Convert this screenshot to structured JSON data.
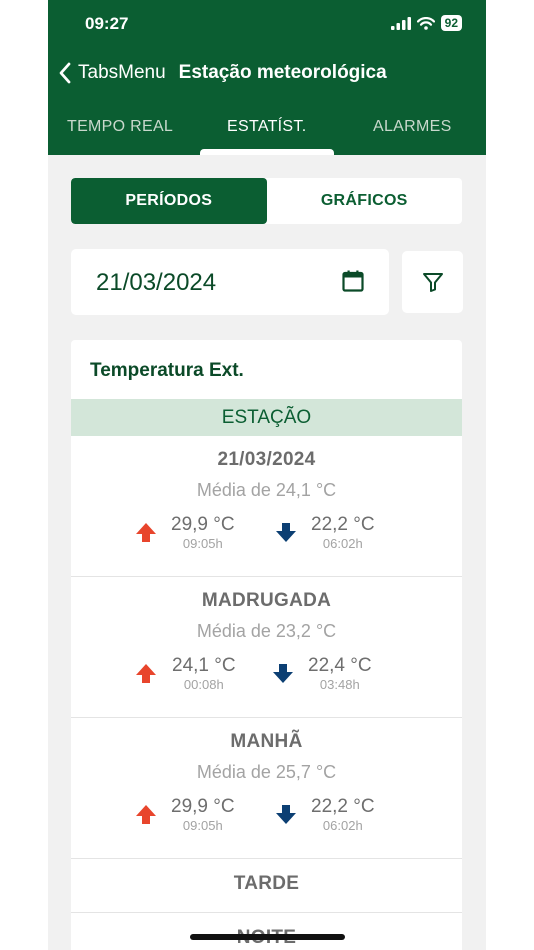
{
  "status_bar": {
    "time": "09:27",
    "battery": "92"
  },
  "nav": {
    "back_label": "TabsMenu",
    "title": "Estação meteorológica"
  },
  "tabs": [
    {
      "label": "TEMPO REAL"
    },
    {
      "label": "ESTATÍST."
    },
    {
      "label": "ALARMES"
    }
  ],
  "segmented": {
    "periods": "PERÍODOS",
    "charts": "GRÁFICOS"
  },
  "date_filter": {
    "date": "21/03/2024"
  },
  "card": {
    "title": "Temperatura Ext.",
    "section": "ESTAÇÃO",
    "periods": [
      {
        "title": "21/03/2024",
        "average": "Média de 24,1 °C",
        "max_value": "29,9 °C",
        "max_time": "09:05h",
        "min_value": "22,2 °C",
        "min_time": "06:02h"
      },
      {
        "title": "MADRUGADA",
        "average": "Média de 23,2 °C",
        "max_value": "24,1 °C",
        "max_time": "00:08h",
        "min_value": "22,4 °C",
        "min_time": "03:48h"
      },
      {
        "title": "MANHÃ",
        "average": "Média de 25,7 °C",
        "max_value": "29,9 °C",
        "max_time": "09:05h",
        "min_value": "22,2 °C",
        "min_time": "06:02h"
      }
    ],
    "collapsed": [
      {
        "title": "TARDE"
      },
      {
        "title": "NOITE"
      }
    ]
  },
  "colors": {
    "brand": "#0b5e32",
    "up": "#e8452c",
    "down": "#0c3f73"
  }
}
